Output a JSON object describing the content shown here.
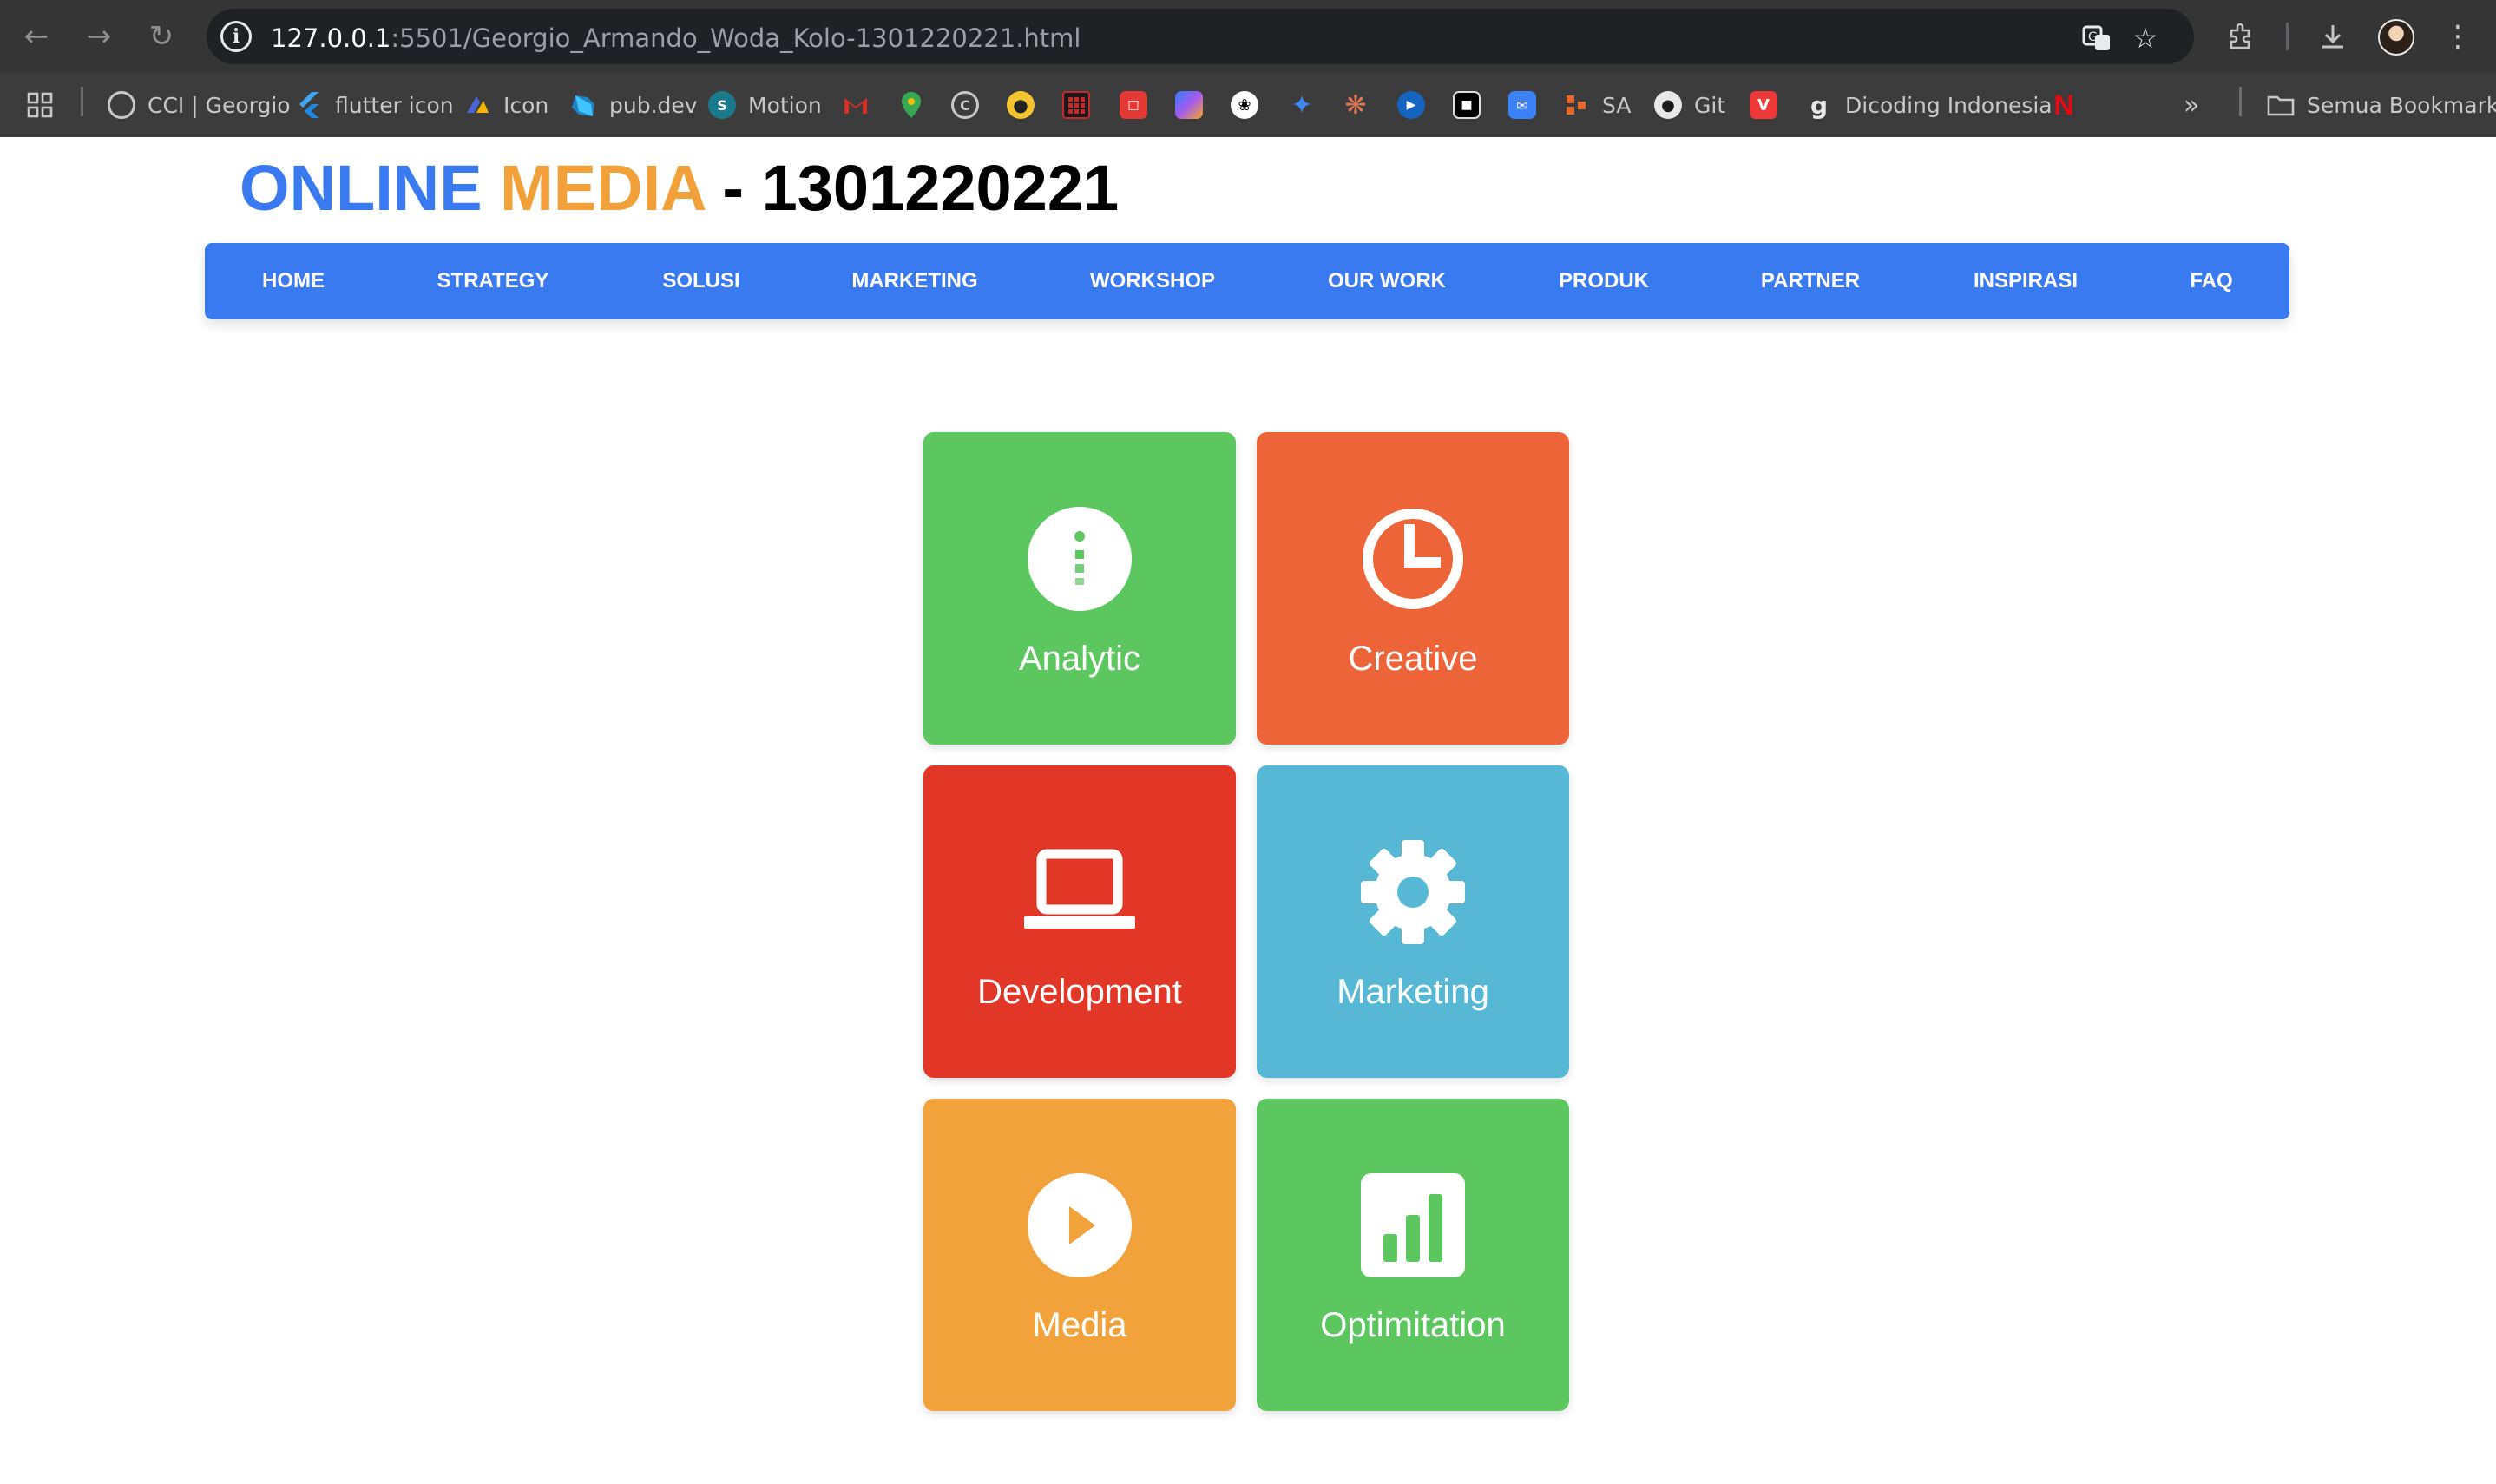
{
  "browser": {
    "url_host": "127.0.0.1",
    "url_rest": ":5501/Georgio_Armando_Woda_Kolo-1301220221.html",
    "bookmarks": [
      {
        "label": "CCI | Georgio",
        "icon": "globe-icon",
        "color": "#5f6368"
      },
      {
        "label": "flutter icon",
        "icon": "flutter-icon",
        "color": "#42a5f5"
      },
      {
        "label": "Icon",
        "icon": "icon-site-icon",
        "color": "#4a66d6"
      },
      {
        "label": "pub.dev",
        "icon": "dart-icon",
        "color": "#1f82c5"
      },
      {
        "label": "Motion",
        "icon": "motion-icon",
        "color": "#1a7a8c"
      },
      {
        "label": "SA",
        "icon": "sa-icon",
        "color": "#e6682a"
      },
      {
        "label": "Git",
        "icon": "github-icon",
        "color": "#e8e8e8"
      },
      {
        "label": "Dicoding Indonesia",
        "icon": "dicoding-icon",
        "color": "#e8e8e8"
      }
    ],
    "icon_only_bookmarks": [
      {
        "icon": "gmail-icon",
        "color": "#d93025"
      },
      {
        "icon": "maps-icon",
        "color": "#34a853"
      },
      {
        "icon": "clock-icon",
        "color": "#9aa0a6"
      },
      {
        "icon": "football-icon",
        "color": "#f4c430"
      },
      {
        "icon": "app-grid-icon",
        "color": "#c62828"
      },
      {
        "icon": "calendar-icon",
        "color": "#e53935"
      },
      {
        "icon": "copilot-icon",
        "color": "#7b61ff"
      },
      {
        "icon": "openai-icon",
        "color": "#ffffff"
      },
      {
        "icon": "gemini-icon",
        "color": "#4285f4"
      },
      {
        "icon": "claude-icon",
        "color": "#d97757"
      },
      {
        "icon": "play-icon",
        "color": "#1565c0"
      },
      {
        "icon": "capcut-icon",
        "color": "#000000"
      },
      {
        "icon": "mail-icon",
        "color": "#3b82f6"
      }
    ],
    "all_bookmarks_label": "Semua Bookmark",
    "netflix_icon": "netflix-icon",
    "vivaldi_icon": "vivaldi-icon"
  },
  "header": {
    "title_part1": "ONLINE",
    "title_part2": "MEDIA",
    "title_part3": " - 1301220221",
    "colors": {
      "online": "#3a7af0",
      "media": "#f2a03a"
    }
  },
  "nav": {
    "background": "#3a7af0",
    "items": [
      "HOME",
      "STRATEGY",
      "SOLUSI",
      "MARKETING",
      "WORKSHOP",
      "OUR WORK",
      "PRODUK",
      "PARTNER",
      "INSPIRASI",
      "FAQ"
    ]
  },
  "tiles": [
    {
      "label": "Analytic",
      "icon": "info-icon",
      "color": "#5cc65f"
    },
    {
      "label": "Creative",
      "icon": "clock-icon",
      "color": "#ec6437"
    },
    {
      "label": "Development",
      "icon": "laptop-icon",
      "color": "#e23626"
    },
    {
      "label": "Marketing",
      "icon": "gear-icon",
      "color": "#56b8d4"
    },
    {
      "label": "Media",
      "icon": "play-circle-icon",
      "color": "#f2a23b"
    },
    {
      "label": "Optimitation",
      "icon": "bar-chart-icon",
      "color": "#5cc65f"
    }
  ]
}
